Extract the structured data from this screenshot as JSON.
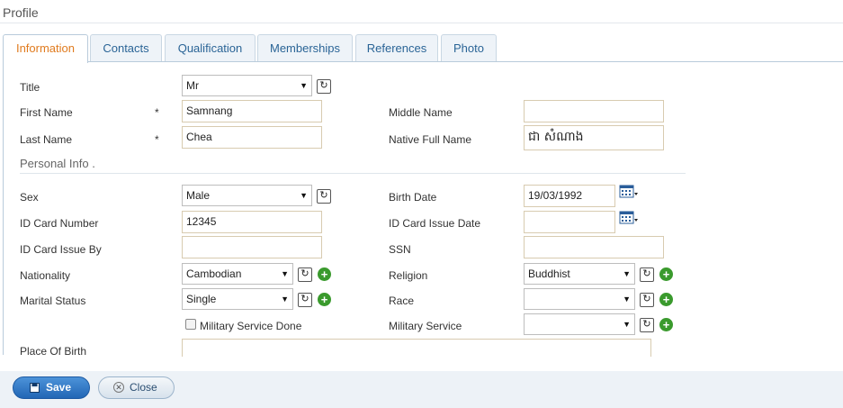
{
  "page": {
    "title": "Profile"
  },
  "tabs": [
    {
      "label": "Information",
      "active": true
    },
    {
      "label": "Contacts"
    },
    {
      "label": "Qualification"
    },
    {
      "label": "Memberships"
    },
    {
      "label": "References"
    },
    {
      "label": "Photo"
    }
  ],
  "form": {
    "title": {
      "label": "Title",
      "value": "Mr"
    },
    "first_name": {
      "label": "First Name",
      "required": "*",
      "value": "Samnang"
    },
    "middle_name": {
      "label": "Middle Name",
      "value": ""
    },
    "last_name": {
      "label": "Last Name",
      "required": "*",
      "value": "Chea"
    },
    "native_full_name": {
      "label": "Native Full Name",
      "value": "ជា សំណាង"
    },
    "section_personal": "Personal Info .",
    "sex": {
      "label": "Sex",
      "value": "Male"
    },
    "birth_date": {
      "label": "Birth Date",
      "value": "19/03/1992"
    },
    "id_card_number": {
      "label": "ID Card Number",
      "value": "12345"
    },
    "id_card_issue_date": {
      "label": "ID Card Issue Date",
      "value": ""
    },
    "id_card_issue_by": {
      "label": "ID Card Issue By",
      "value": ""
    },
    "ssn": {
      "label": "SSN",
      "value": ""
    },
    "nationality": {
      "label": "Nationality",
      "value": "Cambodian"
    },
    "religion": {
      "label": "Religion",
      "value": "Buddhist"
    },
    "marital_status": {
      "label": "Marital Status",
      "value": "Single"
    },
    "race": {
      "label": "Race",
      "value": ""
    },
    "military_service_done": {
      "label": "Military Service Done",
      "checked": false
    },
    "military_service": {
      "label": "Military Service",
      "value": ""
    },
    "place_of_birth": {
      "label": "Place Of Birth",
      "value": ""
    }
  },
  "footer": {
    "save_label": "Save",
    "close_label": "Close"
  },
  "colors": {
    "accent_tab": "#e07b1f",
    "link_blue": "#2a6496",
    "save_blue": "#2266b5",
    "add_green": "#3a9a2d"
  }
}
